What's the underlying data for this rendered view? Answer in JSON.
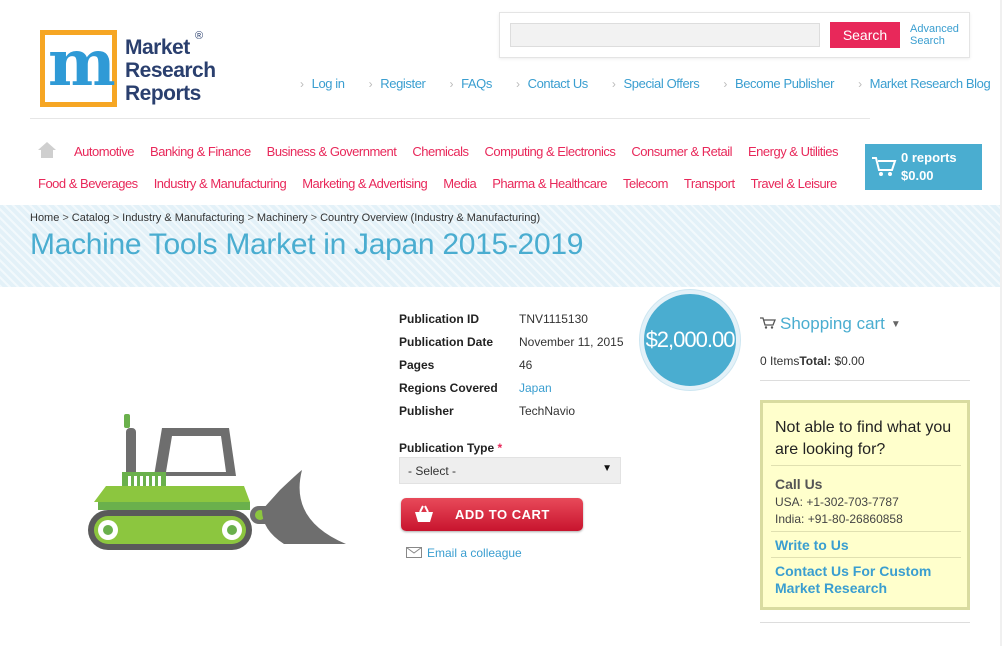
{
  "logo": {
    "line1": "Market",
    "line2": "Research",
    "line3": "Reports",
    "mark": "m",
    "registered": "®"
  },
  "search": {
    "placeholder": "",
    "button": "Search",
    "advanced": "Advanced Search"
  },
  "toplinks": [
    "Log in",
    "Register",
    "FAQs",
    "Contact Us",
    "Special Offers",
    "Become Publisher",
    "Market Research Blog"
  ],
  "categories_row1": [
    "Automotive",
    "Banking & Finance",
    "Business & Government",
    "Chemicals",
    "Computing & Electronics",
    "Consumer & Retail",
    "Energy & Utilities"
  ],
  "categories_row2": [
    "Food & Beverages",
    "Industry & Manufacturing",
    "Marketing & Advertising",
    "Media",
    "Pharma & Healthcare",
    "Telecom",
    "Transport",
    "Travel & Leisure"
  ],
  "cart_button": {
    "reports": "0 reports",
    "amount": "$0.00"
  },
  "breadcrumb": [
    "Home",
    "Catalog",
    "Industry & Manufacturing",
    "Machinery",
    "Country Overview (Industry & Manufacturing)"
  ],
  "breadcrumb_sep": ">",
  "title": "Machine Tools Market in Japan 2015-2019",
  "details": [
    {
      "label": "Publication ID",
      "value": "TNV1115130",
      "link": false
    },
    {
      "label": "Publication Date",
      "value": "November 11, 2015",
      "link": false
    },
    {
      "label": "Pages",
      "value": "46",
      "link": false
    },
    {
      "label": "Regions Covered",
      "value": "Japan",
      "link": true
    },
    {
      "label": "Publisher",
      "value": "TechNavio",
      "link": false
    }
  ],
  "price": "$2,000.00",
  "publication_type": {
    "label": "Publication Type",
    "required": "*",
    "selected": "- Select -"
  },
  "add_to_cart": "ADD TO CART",
  "email_colleague": "Email a colleague",
  "shopping_cart": {
    "title": "Shopping cart",
    "items": "0 Items",
    "total_label": "Total:",
    "total": "$0.00"
  },
  "help": {
    "title": "Not able to find what you are looking for?",
    "call": "Call Us",
    "usa": "USA: +1-302-703-7787",
    "india": "India: +91-80-26860858",
    "write": "Write to Us",
    "custom": "Contact Us For Custom Market Research"
  },
  "colors": {
    "accent_blue": "#4aadd0",
    "accent_pink": "#e8285a",
    "logo_orange": "#f6a623"
  }
}
